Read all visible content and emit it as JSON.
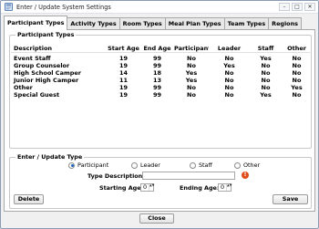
{
  "window": {
    "title": "Enter / Update System Settings",
    "controls": [
      "–",
      "□",
      "✕"
    ]
  },
  "tabs": [
    {
      "label": "Participant Types",
      "active": true
    },
    {
      "label": "Activity Types",
      "active": false
    },
    {
      "label": "Room Types",
      "active": false
    },
    {
      "label": "Meal Plan Types",
      "active": false
    },
    {
      "label": "Team Types",
      "active": false
    },
    {
      "label": "Regions",
      "active": false
    }
  ],
  "participant_types": {
    "group_title": "Participant Types",
    "columns": [
      "Description",
      "Start Age",
      "End Age",
      "Participant",
      "Leader",
      "Staff",
      "Other"
    ],
    "rows": [
      [
        "Event Staff",
        "19",
        "99",
        "No",
        "No",
        "Yes",
        "No"
      ],
      [
        "Group Counselor",
        "19",
        "99",
        "No",
        "Yes",
        "No",
        "No"
      ],
      [
        "High School Camper",
        "14",
        "18",
        "Yes",
        "No",
        "No",
        "No"
      ],
      [
        "Junior High Camper",
        "11",
        "13",
        "Yes",
        "No",
        "No",
        "No"
      ],
      [
        "Other",
        "19",
        "99",
        "No",
        "No",
        "No",
        "Yes"
      ],
      [
        "Special Guest",
        "19",
        "99",
        "No",
        "No",
        "Yes",
        "No"
      ]
    ]
  },
  "form": {
    "group_title": "Enter / Update Type",
    "radios": [
      {
        "label": "Participant",
        "checked": true
      },
      {
        "label": "Leader",
        "checked": false
      },
      {
        "label": "Staff",
        "checked": false
      },
      {
        "label": "Other",
        "checked": false
      }
    ],
    "type_description_label": "Type Description:",
    "type_description_value": "",
    "error_glyph": "!",
    "starting_age_label": "Starting Age:",
    "starting_age_value": "0",
    "ending_age_label": "Ending Age:",
    "ending_age_value": "0",
    "spin_arrows": "▲▼"
  },
  "buttons": {
    "delete": "Delete",
    "save": "Save",
    "close": "Close"
  }
}
